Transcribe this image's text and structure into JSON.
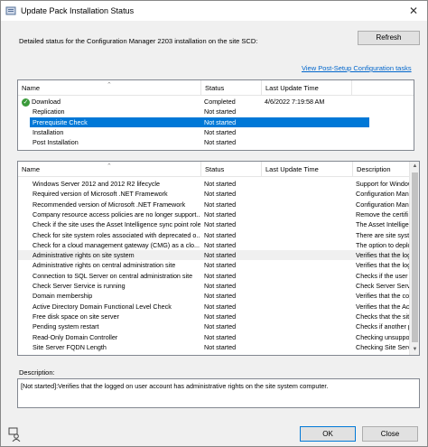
{
  "window": {
    "title": "Update Pack Installation Status",
    "close_glyph": "✕"
  },
  "status_line": "Detailed status for the Configuration Manager 2203 installation on the site SCD:",
  "refresh_label": "Refresh",
  "link_label": "View Post-Setup Configuration tasks",
  "top_list": {
    "headers": [
      "Name",
      "Status",
      "Last Update Time"
    ],
    "rows": [
      {
        "name": "Download",
        "status": "Completed",
        "time": "4/6/2022 7:19:58 AM",
        "icon": "green-check-icon"
      },
      {
        "name": "Replication",
        "status": "Not started",
        "time": ""
      },
      {
        "name": "Prerequisite Check",
        "status": "Not started",
        "time": "",
        "selected": true
      },
      {
        "name": "Installation",
        "status": "Not started",
        "time": ""
      },
      {
        "name": "Post Installation",
        "status": "Not started",
        "time": ""
      }
    ]
  },
  "bottom_list": {
    "headers": [
      "Name",
      "Status",
      "Last Update Time",
      "Description"
    ],
    "rows": [
      {
        "name": "Windows Server 2012 and 2012 R2 lifecycle",
        "status": "Not started",
        "desc": "Support for Window"
      },
      {
        "name": "Required version of Microsoft .NET Framework",
        "status": "Not started",
        "desc": "Configuration Mana"
      },
      {
        "name": "Recommended version of Microsoft .NET Framework",
        "status": "Not started",
        "desc": "Configuration Mana"
      },
      {
        "name": "Company resource access policies are no longer support...",
        "status": "Not started",
        "desc": "Remove the certifi"
      },
      {
        "name": "Check if the site uses the Asset Intelligence sync point role",
        "status": "Not started",
        "desc": "The Asset Intelligen"
      },
      {
        "name": "Check for site system roles associated with deprecated o...",
        "status": "Not started",
        "desc": "There are site syst"
      },
      {
        "name": "Check for a cloud management gateway (CMG) as a clo...",
        "status": "Not started",
        "desc": "The option to deploy"
      },
      {
        "name": "Administrative rights on site system",
        "status": "Not started",
        "desc": "Verifies that the log",
        "grey": true
      },
      {
        "name": "Administrative rights on central administration site",
        "status": "Not started",
        "desc": "Verifies that the log"
      },
      {
        "name": "Connection to SQL Server on central administration site",
        "status": "Not started",
        "desc": "Checks if the user a"
      },
      {
        "name": "Check Server Service is running",
        "status": "Not started",
        "desc": "Check Server Service"
      },
      {
        "name": "Domain membership",
        "status": "Not started",
        "desc": "Verifies that the co"
      },
      {
        "name": "Active Directory Domain Functional Level Check",
        "status": "Not started",
        "desc": "Verifies that the Act"
      },
      {
        "name": "Free disk space on site server",
        "status": "Not started",
        "desc": "Checks that the site"
      },
      {
        "name": "Pending system restart",
        "status": "Not started",
        "desc": "Checks if another p"
      },
      {
        "name": "Read-Only Domain Controller",
        "status": "Not started",
        "desc": "Checking unsuppo"
      },
      {
        "name": "Site Server FQDN Length",
        "status": "Not started",
        "desc": "Checking Site Serv"
      }
    ]
  },
  "description_label": "Description:",
  "description_text": "[Not started]:Verifies that the logged on user account has administrative rights on the site system computer.",
  "ok_label": "OK",
  "close_label": "Close",
  "colors": {
    "accent": "#0078d7",
    "link": "#0066cc",
    "check": "#3a9a3a"
  }
}
